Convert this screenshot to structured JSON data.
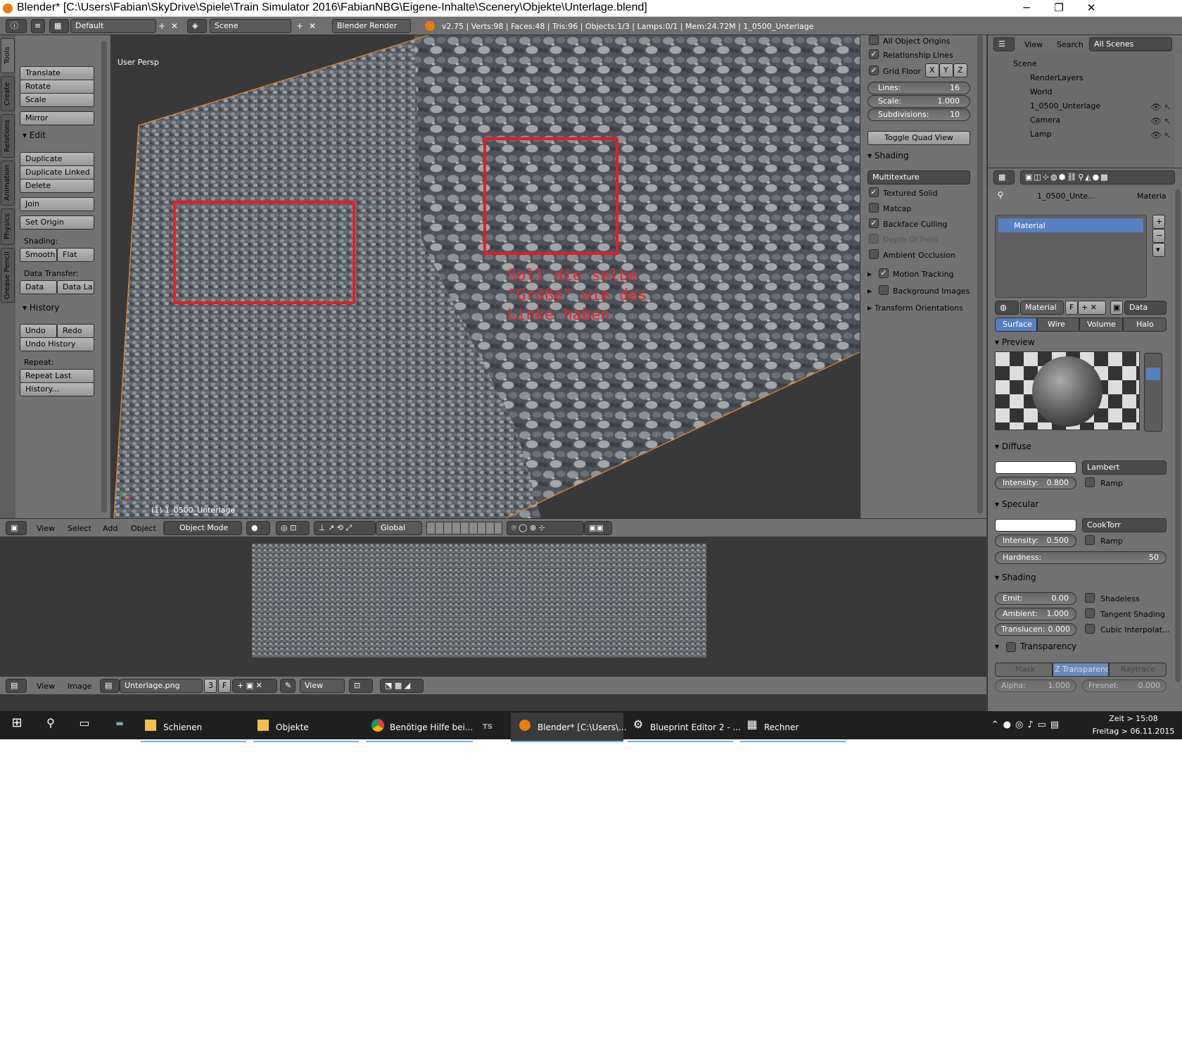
{
  "window": {
    "title": "Blender* [C:\\Users\\Fabian\\SkyDrive\\Spiele\\Train Simulator 2016\\FabianNBG\\Eigene-Inhalte\\Scenery\\Objekte\\Unterlage.blend]",
    "minimize": "─",
    "maximize": "❐",
    "close": "✕"
  },
  "topbar": {
    "layout": "Default",
    "scene": "Scene",
    "engine": "Blender Render",
    "stats": "v2.75 | Verts:98 | Faces:48 | Tris:96 | Objects:1/3 | Lamps:0/1 | Mem:24.72M | 1_0500_Unterlage"
  },
  "toolshelf": {
    "tabs": [
      "Tools",
      "Create",
      "Relations",
      "Animation",
      "Physics",
      "Grease Pencil"
    ],
    "transform_buttons": [
      "Translate",
      "Rotate",
      "Scale"
    ],
    "mirror": "Mirror",
    "edit_header": "Edit",
    "edit_buttons": [
      "Duplicate",
      "Duplicate Linked",
      "Delete"
    ],
    "join": "Join",
    "set_origin": "Set Origin",
    "shading_label": "Shading:",
    "smooth": "Smooth",
    "flat": "Flat",
    "data_transfer_label": "Data Transfer:",
    "data": "Data",
    "data_la": "Data La",
    "history_header": "History",
    "undo": "Undo",
    "redo": "Redo",
    "undo_history": "Undo History",
    "repeat_label": "Repeat:",
    "repeat_last": "Repeat Last",
    "history_btn": "History..."
  },
  "viewport": {
    "persp": "User Persp",
    "object_label": "(1) 1_0500_Unterlage",
    "annotation": [
      "Soll die selbe",
      "\"Größe\" wie das",
      "Linke haben"
    ],
    "annotation_color": "#e8242c"
  },
  "nprops": {
    "all_object_origins": "All Object Origins",
    "relationship_lines": "Relationship Lines",
    "grid_floor": "Grid Floor",
    "x": "X",
    "y": "Y",
    "z": "Z",
    "lines_label": "Lines:",
    "lines_val": "16",
    "scale_label": "Scale:",
    "scale_val": "1.000",
    "subdiv_label": "Subdivisions:",
    "subdiv_val": "10",
    "toggle_quad": "Toggle Quad View",
    "shading_header": "Shading",
    "shading_mode": "Multitexture",
    "textured_solid": "Textured Solid",
    "matcap": "Matcap",
    "backface": "Backface Culling",
    "dof": "Depth Of Field",
    "ao": "Ambient Occlusion",
    "motion_tracking": "Motion Tracking",
    "background_images": "Background Images",
    "transform_orient": "Transform Orientations"
  },
  "view3d_header": {
    "view": "View",
    "select": "Select",
    "add": "Add",
    "object": "Object",
    "mode": "Object Mode",
    "orient": "Global"
  },
  "image_header": {
    "view": "View",
    "image": "Image",
    "image_name": "Unterlage.png",
    "users": "3",
    "fake": "F",
    "view_btn": "View"
  },
  "outliner": {
    "view": "View",
    "search": "Search",
    "filter": "All Scenes",
    "items": [
      "Scene",
      "RenderLayers",
      "World",
      "1_0500_Unterlage",
      "Camera",
      "Lamp"
    ]
  },
  "properties": {
    "obj_name": "1_0500_Unte...",
    "mat_crumb": "Materia",
    "slot": "Material",
    "mat_field": "Material",
    "f": "F",
    "data_dd": "Data",
    "tabs": [
      "Surface",
      "Wire",
      "Volume",
      "Halo"
    ],
    "preview_header": "Preview",
    "diffuse_header": "Diffuse",
    "diffuse_shader": "Lambert",
    "intensity_label": "Intensity:",
    "diffuse_intensity": "0.800",
    "ramp": "Ramp",
    "specular_header": "Specular",
    "spec_shader": "CookTorr",
    "spec_intensity": "0.500",
    "hardness_label": "Hardness:",
    "hardness": "50",
    "shading_header": "Shading",
    "emit_label": "Emit:",
    "emit": "0.00",
    "shadeless": "Shadeless",
    "ambient_label": "Ambient:",
    "ambient": "1.000",
    "tangent": "Tangent Shading",
    "translucen_label": "Translucen:",
    "translucen": "0.000",
    "cubic": "Cubic Interpolat...",
    "transparency_header": "Transparency",
    "mask": "Mask",
    "ztrans": "Z Transparency",
    "raytrace": "Raytrace",
    "alpha_label": "Alpha:",
    "alpha": "1.000",
    "fresnel_label": "Fresnel:",
    "fresnel": "0.000"
  },
  "taskbar": {
    "items": [
      "Schienen",
      "Objekte",
      "Benötige Hilfe bei...",
      "Blender* [C:\\Users\\...",
      "Blueprint Editor 2 - ...",
      "Rechner"
    ],
    "ts": "TS",
    "time": "Zeit > 15:08",
    "date": "Freitag > 06.11.2015"
  }
}
